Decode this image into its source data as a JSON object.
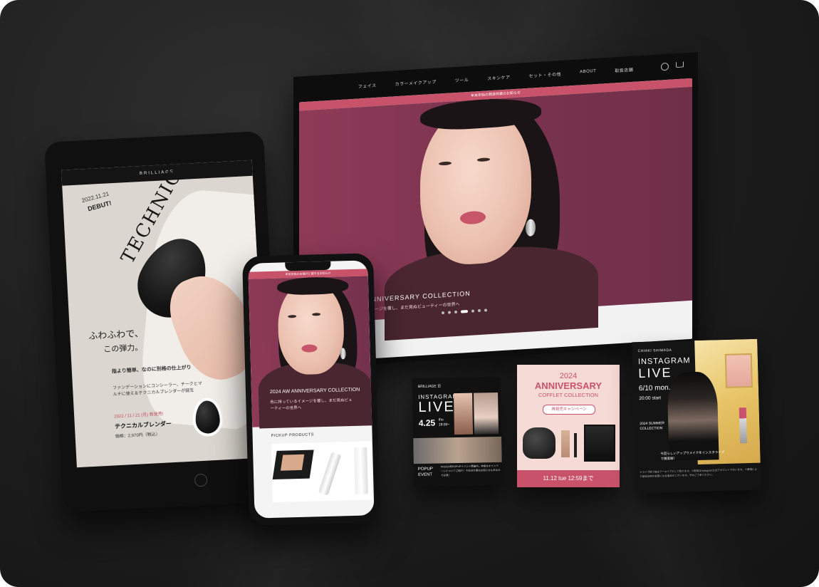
{
  "laptop": {
    "nav": [
      "フェイス",
      "カラーメイクアップ",
      "ツール",
      "スキンケア",
      "セット・その他",
      "ABOUT",
      "取扱店舗"
    ],
    "banner": "年末年始の発送休業のお知らせ",
    "hero_title": "W ANNIVERSARY COLLECTION",
    "hero_sub": "いるイメージを覆し、まだ見ぬビューティーの世界へ"
  },
  "tablet": {
    "brand": "BRILLIAGE",
    "date": "2022.11.21",
    "debut": "DEBUT!",
    "headline": "TECHNICAL BLENDER",
    "soft1": "ふわふわで、",
    "soft2": "この弾力。",
    "lead": "指より簡単、なのに別格の仕上がり",
    "body": "ファンデーションにコンシーラー、チークとマルチに使えるテクニカルブレンダーが誕生",
    "pdate": "2022 / 11 / 21 (月) 新発売!",
    "pname": "テクニカルブレンダー",
    "pprice": "価格：2,970円（税込）"
  },
  "phone": {
    "bar": "年末年始のお届けに関するお知らせ",
    "hero_title": "2024 AW ANNIVERSARY COLLECTION",
    "hero_sub": "色に持っているイメージを覆し、まだ見ぬビューティーの世界へ",
    "pickup": "PICKUP PRODUCTS"
  },
  "card1": {
    "brand": "BRILLIAGE 日",
    "insta": "INSTAGRAM",
    "live": "LIVE",
    "date": "4.25",
    "day": "thu",
    "time": "19:00~",
    "popup": "POPUP EVENT",
    "text": "PR2024年POPUPイベント開催中。本格なキャンペーンについてご紹介！今日は大事なお知らせもあるので必見！"
  },
  "card2": {
    "year": "2024",
    "title": "ANNIVERSARY",
    "subtitle": "COFFLET COLLECTION",
    "campaign": "再発売キャンペーン",
    "deadline": "11.12 tue 12:59まで"
  },
  "card3": {
    "name": "CHIAKI SHIMADA",
    "insta": "INSTAGRAM",
    "live": "LIVE",
    "date": "6/10 mon.",
    "time": "20:00 start",
    "collection": "2024 SUMMER COLLECTION",
    "desc": "今回らしいアップワメイクをインスタライブで徹底解！",
    "note": "※ライブ終了後はアーカイブとして残ります。※配信はInstagram公式アカウントで行います。※事情により配信日時が変更になる場合がございます。予めご了承ください。"
  },
  "colors": {
    "accent": "#c8526a",
    "hero": "#8a3853",
    "dark": "#141414"
  }
}
